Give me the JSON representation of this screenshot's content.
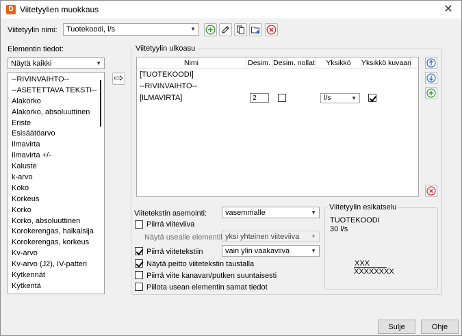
{
  "window": {
    "title": "Viitetyylien muokkaus",
    "app_icon_letter": "D",
    "close_glyph": "✕"
  },
  "style_name": {
    "label": "Viitetyylin nimi:",
    "value": "Tuotekoodi, l/s"
  },
  "toolbar": {
    "add_icon": "plus-circle-green",
    "edit_icon": "pencil",
    "copy_icon": "copy",
    "folder_icon": "folder-open",
    "delete_icon": "delete-circle-red"
  },
  "element_info": {
    "label": "Elementin tiedot:",
    "filter": "Näytä kaikki",
    "items": [
      "--RIVINVAIHTO--",
      "--ASETETTAVA TEKSTI--",
      "Alakorko",
      "Alakorko, absoluuttinen",
      "Eriste",
      "Esisäätöarvo",
      "Ilmavirta",
      "Ilmavirta +/-",
      "Kaluste",
      "k-arvo",
      "Koko",
      "Korkeus",
      "Korko",
      "Korko, absoluuttinen",
      "Korokerengas, halkaisija",
      "Korokerengas, korkeus",
      "Kv-arvo",
      "Kv-arvo (J2), IV-patteri",
      "Kytkennät",
      "Kytkentä"
    ],
    "move_arrow": "⇨"
  },
  "appearance": {
    "group_title": "Viitetyylin ulkoasu",
    "columns": [
      "Nimi",
      "Desim.",
      "Desim. nollat",
      "Yksikkö",
      "Yksikkö kuvaan"
    ],
    "rows": [
      {
        "name": "[TUOTEKOODI]"
      },
      {
        "name": "--RIVINVAIHTO--"
      },
      {
        "name": "[ILMAVIRTA]",
        "decimals": "2",
        "decimal_zeros": false,
        "unit": "l/s",
        "unit_in_picture": true
      }
    ]
  },
  "options": {
    "positioning_label": "Viitetekstin asemointi:",
    "positioning_value": "vasemmalle",
    "draw_leader_label": "Piirrä viiteviiva",
    "draw_leader_checked": false,
    "multi_label": "Näytä usealle elementille",
    "multi_value": "yksi yhteinen viiteviiva",
    "draw_text_label": "Piirrä viitetekstiin",
    "draw_text_checked": true,
    "draw_text_value": "vain ylin vaakaviiva",
    "mask_label": "Näytä peitto viitetekstin taustalla",
    "mask_checked": true,
    "duct_label": "Piirrä viite kanavan/putken suuntaisesti",
    "duct_checked": false,
    "hide_label": "Piilota usean elementin samat tiedot",
    "hide_checked": false
  },
  "preview": {
    "title": "Viitetyylin esikatselu",
    "line1": "TUOTEKOODI",
    "line2": "30 l/s",
    "line3": "XXX",
    "line4": "XXXXXXXX"
  },
  "buttons": {
    "close": "Sulje",
    "help": "Ohje"
  }
}
